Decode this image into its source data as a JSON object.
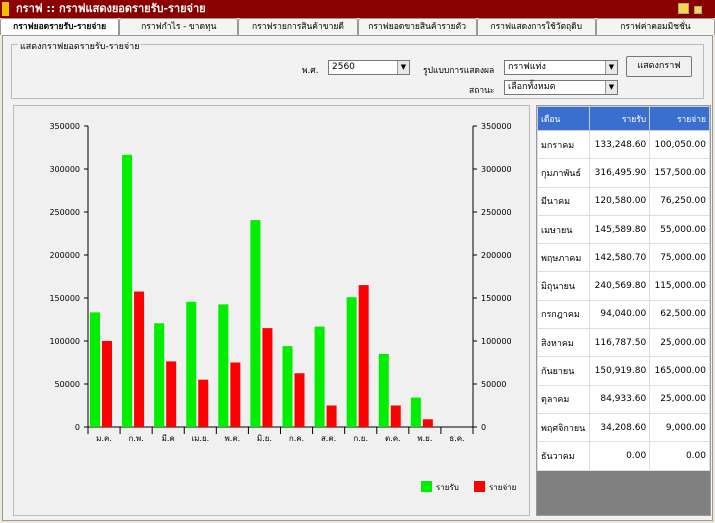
{
  "window": {
    "title": "กราฟ :: กราฟแสดงยอดรายรับ-รายจ่าย"
  },
  "tabs": [
    {
      "label": "กราฟยอดรายรับ-รายจ่าย",
      "active": true
    },
    {
      "label": "กราฟกำไร - ขาดทุน"
    },
    {
      "label": "กราฟรายการสินค้าขายดี"
    },
    {
      "label": "กราฟยอดขายสินค้ารายตัว"
    },
    {
      "label": "กราฟแสดงการใช้วัตถุดิบ"
    },
    {
      "label": "กราฟค่าคอมมิชชั่น"
    }
  ],
  "filters": {
    "group_label": "แสดงกราฟยอดรายรับ-รายจ่าย",
    "year_label": "พ.ศ.",
    "year_value": "2560",
    "format_label": "รูปแบบการแสดงผล",
    "format_value": "กราฟแท่ง",
    "status_label": "สถานะ",
    "status_value": "เลือกทั้งหมด",
    "show_button": "แสดงกราฟ"
  },
  "table": {
    "headers": [
      "เดือน",
      "รายรับ",
      "รายจ่าย"
    ],
    "rows": [
      [
        "มกราคม",
        "133,248.60",
        "100,050.00"
      ],
      [
        "กุมภาพันธ์",
        "316,495.90",
        "157,500.00"
      ],
      [
        "มีนาคม",
        "120,580.00",
        "76,250.00"
      ],
      [
        "เมษายน",
        "145,589.80",
        "55,000.00"
      ],
      [
        "พฤษภาคม",
        "142,580.70",
        "75,000.00"
      ],
      [
        "มิถุนายน",
        "240,569.80",
        "115,000.00"
      ],
      [
        "กรกฎาคม",
        "94,040.00",
        "62,500.00"
      ],
      [
        "สิงหาคม",
        "116,787.50",
        "25,000.00"
      ],
      [
        "กันยายน",
        "150,919.80",
        "165,000.00"
      ],
      [
        "ตุลาคม",
        "84,933.60",
        "25,000.00"
      ],
      [
        "พฤศจิกายน",
        "34,208.60",
        "9,000.00"
      ],
      [
        "ธันวาคม",
        "0.00",
        "0.00"
      ]
    ]
  },
  "chart_data": {
    "type": "bar",
    "categories": [
      "ม.ค.",
      "ก.พ.",
      "มี.ค",
      "เม.ย.",
      "พ.ค.",
      "มิ.ย.",
      "ก.ค.",
      "ส.ค.",
      "ก.ย.",
      "ต.ค.",
      "พ.ย.",
      "ธ.ค."
    ],
    "series": [
      {
        "name": "รายรับ",
        "color": "#00ee00",
        "values": [
          133248.6,
          316495.9,
          120580,
          145589.8,
          142580.7,
          240569.8,
          94040,
          116787.5,
          150919.8,
          84933.6,
          34208.6,
          0
        ]
      },
      {
        "name": "รายจ่าย",
        "color": "#ff0000",
        "values": [
          100050,
          157500,
          76250,
          55000,
          75000,
          115000,
          62500,
          25000,
          165000,
          25000,
          9000,
          0
        ]
      }
    ],
    "ylim": [
      0,
      350000
    ],
    "yticks": [
      "0",
      "50000",
      "100000",
      "150000",
      "200000",
      "250000",
      "300000",
      "350000"
    ],
    "legend": "bottom-right",
    "grid": false
  }
}
